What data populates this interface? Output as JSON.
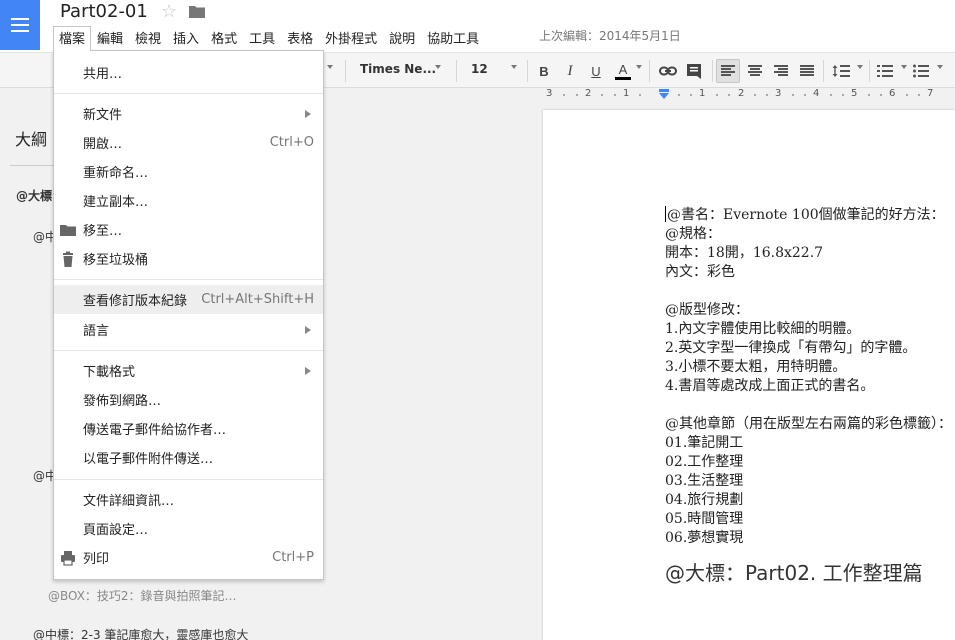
{
  "header": {
    "doc_title": "Part02-01",
    "last_edit": "上次編輯：2014年5月1日",
    "menus": [
      "檔案",
      "編輯",
      "檢視",
      "插入",
      "格式",
      "工具",
      "表格",
      "外掛程式",
      "說明",
      "協助工具"
    ]
  },
  "toolbar": {
    "font_family": "Times Ne...",
    "font_size": "12",
    "bold": "B",
    "italic": "I",
    "underline": "U",
    "text_color": "A"
  },
  "ruler": {
    "labels": [
      "3",
      "2",
      "1",
      "1",
      "2",
      "3",
      "4",
      "5",
      "6",
      "7"
    ]
  },
  "sidebar": {
    "title": "大綱",
    "items": [
      {
        "text": "@大標",
        "style": "bold"
      },
      {
        "text": "@中",
        "style": "normal"
      },
      {
        "text": "@中",
        "style": "normal"
      },
      {
        "text": "@BOX：技巧2：錄音與拍照筆記…",
        "style": "muted"
      },
      {
        "text": "@中標：2-3 筆記庫愈大，靈感庫也愈大",
        "style": "normal"
      }
    ]
  },
  "file_menu": {
    "items": [
      {
        "label": "共用…",
        "shortcut": "",
        "submenu": false,
        "icon": ""
      },
      {
        "label": "新文件",
        "shortcut": "",
        "submenu": true,
        "icon": ""
      },
      {
        "label": "開啟…",
        "shortcut": "Ctrl+O",
        "submenu": false,
        "icon": ""
      },
      {
        "label": "重新命名…",
        "shortcut": "",
        "submenu": false,
        "icon": ""
      },
      {
        "label": "建立副本…",
        "shortcut": "",
        "submenu": false,
        "icon": ""
      },
      {
        "label": "移至…",
        "shortcut": "",
        "submenu": false,
        "icon": "folder-icon"
      },
      {
        "label": "移至垃圾桶",
        "shortcut": "",
        "submenu": false,
        "icon": "trash-icon"
      },
      {
        "label": "查看修訂版本紀錄",
        "shortcut": "Ctrl+Alt+Shift+H",
        "submenu": false,
        "icon": "",
        "highlighted": true
      },
      {
        "label": "語言",
        "shortcut": "",
        "submenu": true,
        "icon": ""
      },
      {
        "label": "下載格式",
        "shortcut": "",
        "submenu": true,
        "icon": ""
      },
      {
        "label": "發佈到網路…",
        "shortcut": "",
        "submenu": false,
        "icon": ""
      },
      {
        "label": "傳送電子郵件給協作者…",
        "shortcut": "",
        "submenu": false,
        "icon": ""
      },
      {
        "label": "以電子郵件附件傳送…",
        "shortcut": "",
        "submenu": false,
        "icon": ""
      },
      {
        "label": "文件詳細資訊…",
        "shortcut": "",
        "submenu": false,
        "icon": ""
      },
      {
        "label": "頁面設定…",
        "shortcut": "",
        "submenu": false,
        "icon": ""
      },
      {
        "label": "列印",
        "shortcut": "Ctrl+P",
        "submenu": false,
        "icon": "print-icon"
      }
    ]
  },
  "document": {
    "lines": [
      "@書名：Evernote 100個做筆記的好方法：",
      "@規格：",
      "開本：18開，16.8x22.7",
      "內文：彩色",
      "",
      "@版型修改：",
      "1.內文字體使用比較細的明體。",
      "2.英文字型一律換成「有帶勾」的字體。",
      "3.小標不要太粗，用特明體。",
      "4.書眉等處改成上面正式的書名。",
      "",
      "@其他章節（用在版型左右兩篇的彩色標籤）：",
      "01.筆記開工",
      "02.工作整理",
      "03.生活整理",
      "04.旅行規劃",
      "05.時間管理",
      "06.夢想實現"
    ],
    "heading": "@大標：Part02. 工作整理篇"
  },
  "colors": {
    "brand_blue": "#4285f4",
    "menu_hover": "#eeeeee"
  }
}
